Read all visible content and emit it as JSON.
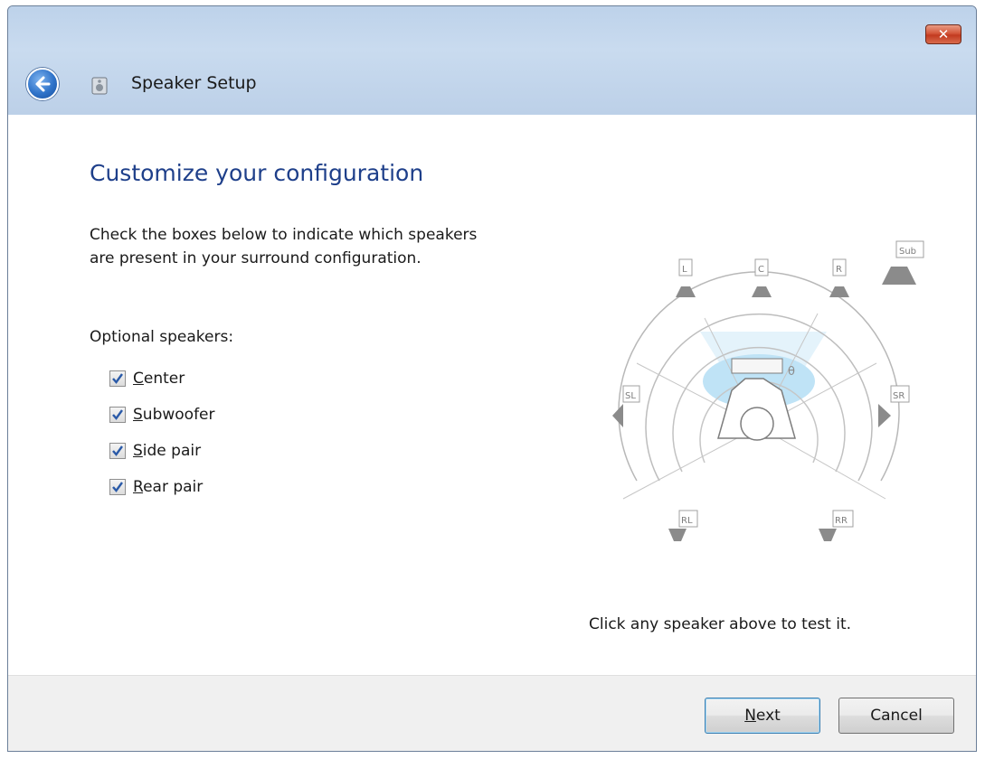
{
  "window": {
    "title": "Speaker Setup",
    "close_label": "✕"
  },
  "page": {
    "heading": "Customize your configuration",
    "instructions": "Check the boxes below to indicate which speakers are present in your surround configuration.",
    "optional_label": "Optional speakers:",
    "options": [
      {
        "mnemonic": "C",
        "rest": "enter",
        "checked": true
      },
      {
        "mnemonic": "S",
        "rest": "ubwoofer",
        "checked": true
      },
      {
        "mnemonic": "S",
        "rest": "ide pair",
        "checked": true
      },
      {
        "mnemonic": "R",
        "rest": "ear pair",
        "checked": true
      }
    ],
    "speaker_labels": {
      "left": "L",
      "center": "C",
      "right": "R",
      "sub": "Sub",
      "side_left": "SL",
      "side_right": "SR",
      "rear_left": "RL",
      "rear_right": "RR"
    },
    "test_hint": "Click any speaker above to test it."
  },
  "footer": {
    "next_label": "Next",
    "next_mnemonic": "N",
    "next_rest": "ext",
    "cancel_label": "Cancel"
  },
  "colors": {
    "heading": "#1e3f8a",
    "close": "#c23a1f",
    "titlebar": "#c5d6ea"
  }
}
